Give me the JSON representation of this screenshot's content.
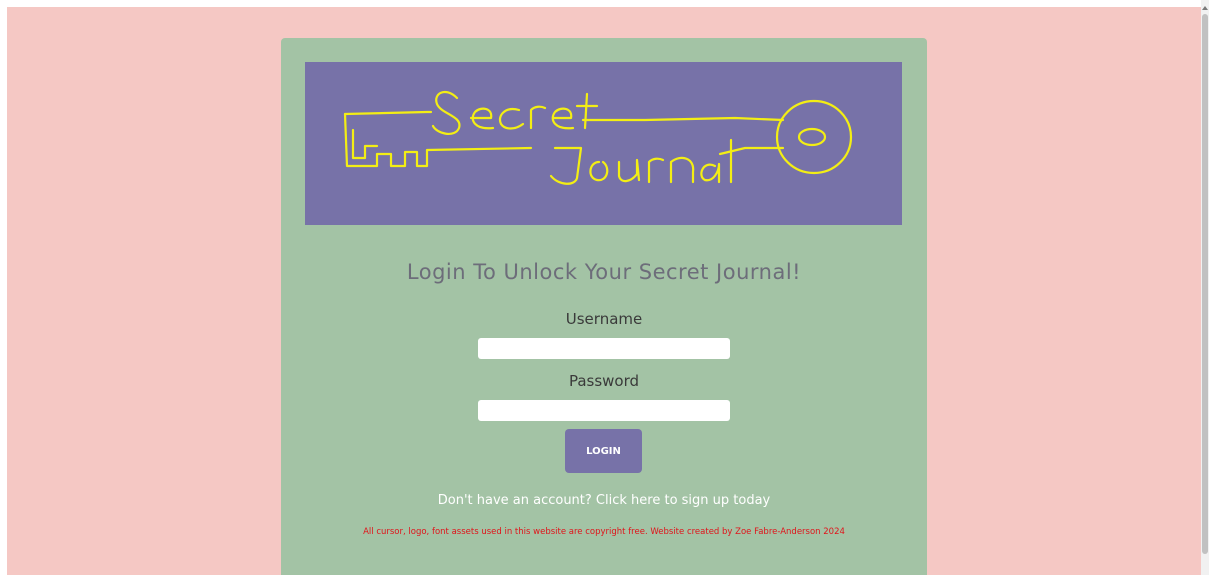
{
  "logo": {
    "text_line1": "Secret",
    "text_line2": "Journal",
    "color": "#f3ee14",
    "background": "#7772a8"
  },
  "form": {
    "title": "Login To Unlock Your Secret Journal!",
    "username_label": "Username",
    "username_value": "",
    "password_label": "Password",
    "password_value": "",
    "login_button": "LOGIN"
  },
  "signup_link": "Don't have an account? Click here to sign up today",
  "footer": "All cursor, logo, font assets used in this website are copyright free. Website created by Zoe Fabre-Anderson 2024",
  "colors": {
    "page_bg": "#f5c8c4",
    "card_bg": "#a3c3a5",
    "accent": "#7772a8",
    "footer_text": "#e0141b"
  }
}
